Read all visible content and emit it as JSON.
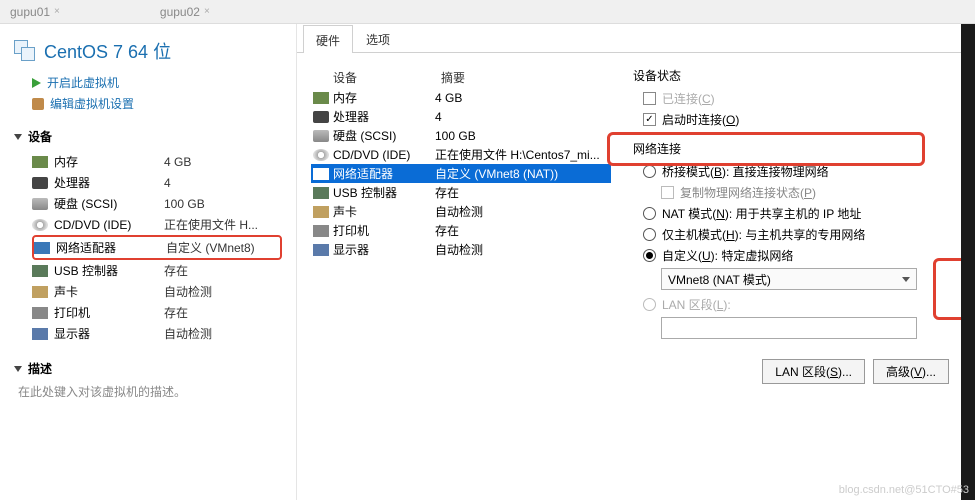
{
  "tabs": {
    "tab1": "gupu01",
    "tab2": "gupu02"
  },
  "vm": {
    "title": "CentOS 7 64 位",
    "power_on": "开启此虚拟机",
    "edit_settings": "编辑虚拟机设置"
  },
  "sections": {
    "devices": "设备",
    "description": "描述"
  },
  "desc_hint": "在此处键入对该虚拟机的描述。",
  "left_devices": [
    {
      "name": "内存",
      "value": "4 GB",
      "ic": "ic-mem"
    },
    {
      "name": "处理器",
      "value": "4",
      "ic": "ic-cpu"
    },
    {
      "name": "硬盘 (SCSI)",
      "value": "100 GB",
      "ic": "ic-hdd"
    },
    {
      "name": "CD/DVD (IDE)",
      "value": "正在使用文件 H...",
      "ic": "ic-cd"
    },
    {
      "name": "网络适配器",
      "value": "自定义 (VMnet8)",
      "ic": "ic-net"
    },
    {
      "name": "USB 控制器",
      "value": "存在",
      "ic": "ic-usb"
    },
    {
      "name": "声卡",
      "value": "自动检测",
      "ic": "ic-snd"
    },
    {
      "name": "打印机",
      "value": "存在",
      "ic": "ic-prn"
    },
    {
      "name": "显示器",
      "value": "自动检测",
      "ic": "ic-dsp"
    }
  ],
  "dlg_tabs": {
    "hardware": "硬件",
    "options": "选项"
  },
  "dlg_headers": {
    "device": "设备",
    "summary": "摘要"
  },
  "dlg_devices": [
    {
      "name": "内存",
      "value": "4 GB",
      "ic": "ic-mem"
    },
    {
      "name": "处理器",
      "value": "4",
      "ic": "ic-cpu"
    },
    {
      "name": "硬盘 (SCSI)",
      "value": "100 GB",
      "ic": "ic-hdd"
    },
    {
      "name": "CD/DVD (IDE)",
      "value": "正在使用文件 H:\\Centos7_mi...",
      "ic": "ic-cd"
    },
    {
      "name": "网络适配器",
      "value": "自定义 (VMnet8 (NAT))",
      "ic": "ic-net"
    },
    {
      "name": "USB 控制器",
      "value": "存在",
      "ic": "ic-usb"
    },
    {
      "name": "声卡",
      "value": "自动检测",
      "ic": "ic-snd"
    },
    {
      "name": "打印机",
      "value": "存在",
      "ic": "ic-prn"
    },
    {
      "name": "显示器",
      "value": "自动检测",
      "ic": "ic-dsp"
    }
  ],
  "status": {
    "title": "设备状态",
    "connected": "已连接(C)",
    "connect_on_power": "启动时连接(O)"
  },
  "net": {
    "title": "网络连接",
    "bridged": "桥接模式(B): 直接连接物理网络",
    "replicate": "复制物理网络连接状态(P)",
    "nat": "NAT 模式(N): 用于共享主机的 IP 地址",
    "hostonly": "仅主机模式(H): 与主机共享的专用网络",
    "custom": "自定义(U): 特定虚拟网络",
    "custom_value": "VMnet8 (NAT 模式)",
    "lan": "LAN 区段(L):"
  },
  "buttons": {
    "lan_seg": "LAN 区段(S)...",
    "advanced": "高级(V)..."
  },
  "watermark": "blog.csdn.net@51CTO#53"
}
